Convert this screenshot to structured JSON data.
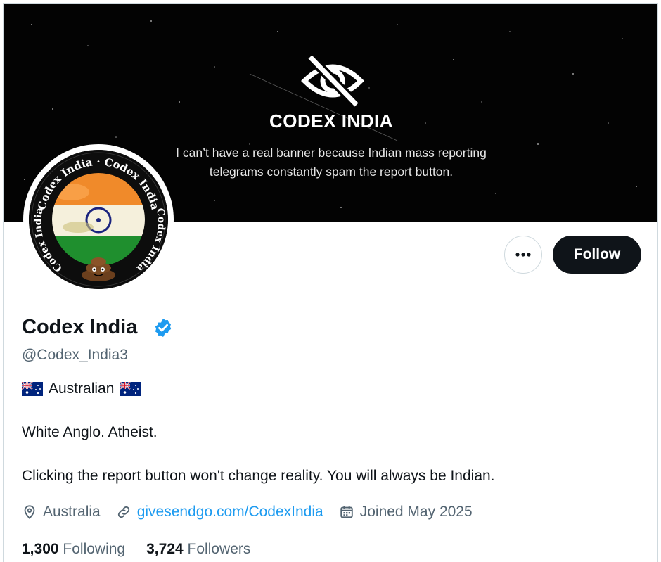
{
  "banner": {
    "title": "CODEX INDIA",
    "caption_line1": "I can’t have a real banner because Indian mass reporting",
    "caption_line2": "telegrams constantly spam the report button."
  },
  "avatar": {
    "ring_text": "Codex India",
    "icon": "poop-emoji"
  },
  "actions": {
    "more_icon": "more-icon",
    "follow_label": "Follow"
  },
  "profile": {
    "name": "Codex India",
    "verified_icon": "verified-badge-icon",
    "handle": "@Codex_India3",
    "bio_line1": "Australian",
    "bio_line2": "White Anglo. Atheist.",
    "bio_line3": "Clicking the report button won't change reality. You will always be Indian.",
    "location": "Australia",
    "website": "givesendgo.com/CodexIndia",
    "joined": "Joined May 2025"
  },
  "stats": {
    "following_count": "1,300",
    "following_label": "Following",
    "followers_count": "3,724",
    "followers_label": "Followers"
  },
  "colors": {
    "accent": "#1d9bf0",
    "text": "#0f1419",
    "muted": "#536471",
    "follow_bg": "#0f1419"
  }
}
